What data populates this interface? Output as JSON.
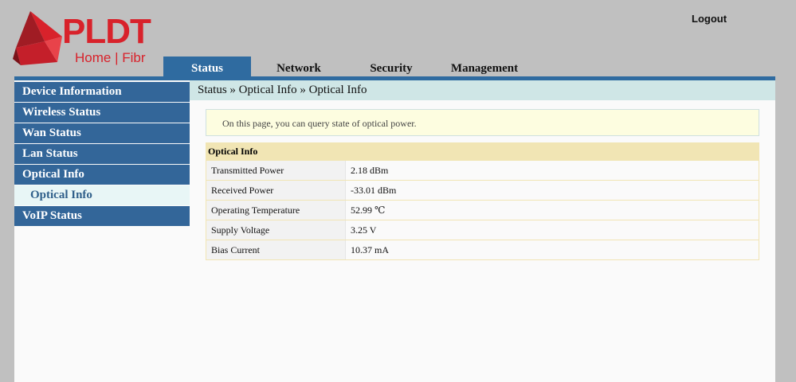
{
  "brand": {
    "name": "PLDT",
    "tagline": "Home | Fibr",
    "color": "#d8222b"
  },
  "header": {
    "logout_label": "Logout"
  },
  "nav": {
    "tabs": [
      {
        "label": "Status",
        "active": true
      },
      {
        "label": "Network",
        "active": false
      },
      {
        "label": "Security",
        "active": false
      },
      {
        "label": "Management",
        "active": false
      }
    ]
  },
  "sidebar": {
    "items": [
      {
        "label": "Device Information"
      },
      {
        "label": "Wireless Status"
      },
      {
        "label": "Wan Status"
      },
      {
        "label": "Lan Status"
      },
      {
        "label": "Optical Info"
      }
    ],
    "sub_item": {
      "label": "Optical Info"
    },
    "after_items": [
      {
        "label": "VoIP Status"
      }
    ]
  },
  "main": {
    "breadcrumb": "Status » Optical Info » Optical Info",
    "notice": "On this page, you can query state of optical power.",
    "table": {
      "header": "Optical Info",
      "rows": [
        {
          "label": "Transmitted Power",
          "value": "2.18 dBm"
        },
        {
          "label": "Received Power",
          "value": "-33.01 dBm"
        },
        {
          "label": "Operating Temperature",
          "value": "52.99 ℃"
        },
        {
          "label": "Supply Voltage",
          "value": "3.25 V"
        },
        {
          "label": "Bias Current",
          "value": "10.37 mA"
        }
      ]
    }
  },
  "colors": {
    "nav_blue": "#2f6ba0",
    "sidebar_blue": "#336699",
    "breadcrumb_bg": "#cfe6e6",
    "table_header_bg": "#f1e5b4"
  }
}
